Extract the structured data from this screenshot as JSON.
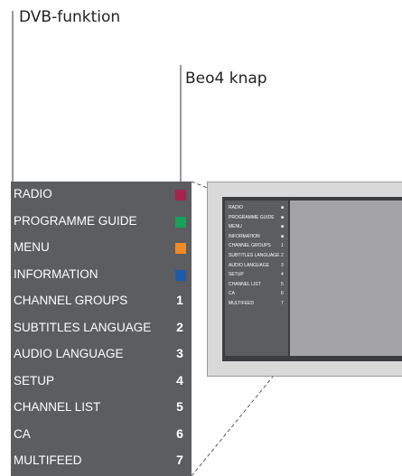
{
  "annotations": {
    "function_label": "DVB-funktion",
    "button_label": "Beo4 knap"
  },
  "menu": {
    "items": [
      {
        "label": "RADIO",
        "swatch": "#a3234a"
      },
      {
        "label": "PROGRAMME GUIDE",
        "swatch": "#1aa05a"
      },
      {
        "label": "MENU",
        "swatch": "#f08a24"
      },
      {
        "label": "INFORMATION",
        "swatch": "#1e5aa8"
      },
      {
        "label": "CHANNEL GROUPS",
        "key": "1"
      },
      {
        "label": "SUBTITLES LANGUAGE",
        "key": "2"
      },
      {
        "label": "AUDIO LANGUAGE",
        "key": "3"
      },
      {
        "label": "SETUP",
        "key": "4"
      },
      {
        "label": "CHANNEL LIST",
        "key": "5"
      },
      {
        "label": "CA",
        "key": "6"
      },
      {
        "label": "MULTIFEED",
        "key": "7"
      }
    ]
  },
  "tv_menu": {
    "items": [
      {
        "label": "RADIO",
        "value": "■"
      },
      {
        "label": "PROGRAMME GUIDE",
        "value": "■"
      },
      {
        "label": "MENU",
        "value": "■"
      },
      {
        "label": "INFORMATION",
        "value": "■"
      },
      {
        "label": "CHANNEL GROUPS",
        "value": "1"
      },
      {
        "label": "SUBTITLES LANGUAGE",
        "value": "2"
      },
      {
        "label": "AUDIO LANGUAGE",
        "value": "3"
      },
      {
        "label": "SETUP",
        "value": "4"
      },
      {
        "label": "CHANNEL LIST",
        "value": "5"
      },
      {
        "label": "CA",
        "value": "6"
      },
      {
        "label": "MULTIFEED",
        "value": "7"
      }
    ]
  }
}
